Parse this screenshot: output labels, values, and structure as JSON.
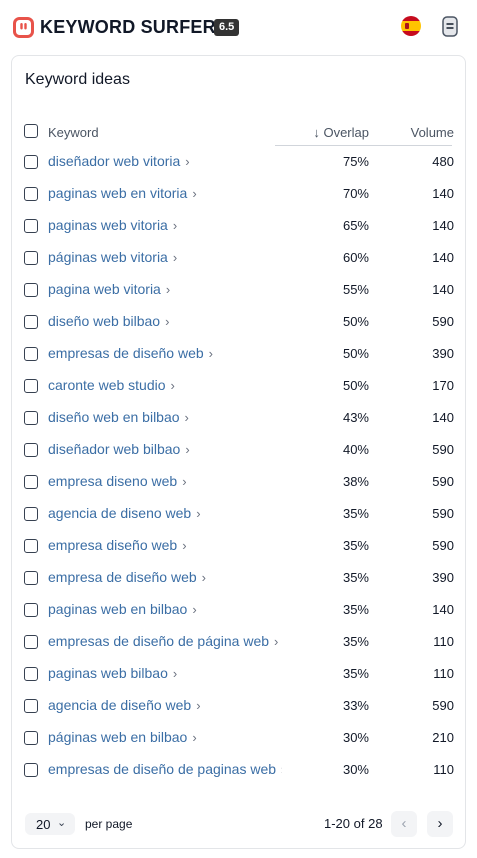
{
  "header": {
    "brand": "KEYWORD SURFER",
    "version": "6.5",
    "logo_icon": "surfer-logo-icon",
    "flag_icon": "spain-flag-icon",
    "menu_icon": "panel-menu-icon"
  },
  "panel": {
    "title": "Keyword ideas",
    "columns": {
      "keyword": "Keyword",
      "sort_arrow": "↓",
      "overlap": "Overlap",
      "volume": "Volume"
    },
    "rows": [
      {
        "keyword": "diseñador web vitoria",
        "overlap": "75%",
        "volume": "480"
      },
      {
        "keyword": "paginas web en vitoria",
        "overlap": "70%",
        "volume": "140"
      },
      {
        "keyword": "paginas web vitoria",
        "overlap": "65%",
        "volume": "140"
      },
      {
        "keyword": "páginas web vitoria",
        "overlap": "60%",
        "volume": "140"
      },
      {
        "keyword": "pagina web vitoria",
        "overlap": "55%",
        "volume": "140"
      },
      {
        "keyword": "diseño web bilbao",
        "overlap": "50%",
        "volume": "590"
      },
      {
        "keyword": "empresas de diseño web",
        "overlap": "50%",
        "volume": "390"
      },
      {
        "keyword": "caronte web studio",
        "overlap": "50%",
        "volume": "170"
      },
      {
        "keyword": "diseño web en bilbao",
        "overlap": "43%",
        "volume": "140"
      },
      {
        "keyword": "diseñador web bilbao",
        "overlap": "40%",
        "volume": "590"
      },
      {
        "keyword": "empresa diseno web",
        "overlap": "38%",
        "volume": "590"
      },
      {
        "keyword": "agencia de diseno web",
        "overlap": "35%",
        "volume": "590"
      },
      {
        "keyword": "empresa diseño web",
        "overlap": "35%",
        "volume": "590"
      },
      {
        "keyword": "empresa de diseño web",
        "overlap": "35%",
        "volume": "390"
      },
      {
        "keyword": "paginas web en bilbao",
        "overlap": "35%",
        "volume": "140"
      },
      {
        "keyword": "empresas de diseño de página web",
        "overlap": "35%",
        "volume": "110"
      },
      {
        "keyword": "paginas web bilbao",
        "overlap": "35%",
        "volume": "110"
      },
      {
        "keyword": "agencia de diseño web",
        "overlap": "33%",
        "volume": "590"
      },
      {
        "keyword": "páginas web en bilbao",
        "overlap": "30%",
        "volume": "210"
      },
      {
        "keyword": "empresas de diseño de paginas web",
        "overlap": "30%",
        "volume": "110"
      }
    ],
    "footer": {
      "per_page_value": "20",
      "per_page_label": "per page",
      "range": "1-20 of 28",
      "prev": "‹",
      "next": "›"
    }
  },
  "colors": {
    "link": "#3b6ea5",
    "logo": "#e8534a",
    "version_badge": "#333333"
  }
}
